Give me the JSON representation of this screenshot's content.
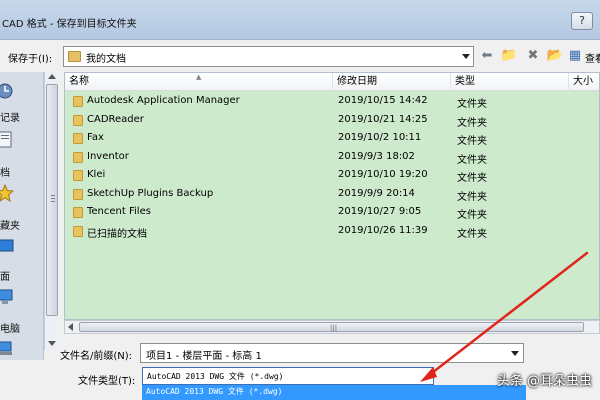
{
  "window": {
    "title": "CAD 格式 - 保存到目标文件夹",
    "help_label": "?"
  },
  "address": {
    "save_in_label": "保存于(I):",
    "current_folder": "我的文档",
    "view_label": "查看"
  },
  "places": {
    "items": [
      {
        "label": "记录",
        "icon": "history-icon"
      },
      {
        "label": "档",
        "icon": "documents-icon"
      },
      {
        "label": "藏夹",
        "icon": "favorites-icon"
      },
      {
        "label": "面",
        "icon": "desktop-icon"
      },
      {
        "label": "电脑",
        "icon": "computer-icon"
      },
      {
        "label": "",
        "icon": "network-icon"
      }
    ]
  },
  "filelist": {
    "columns": [
      "名称",
      "修改日期",
      "类型",
      "大小"
    ],
    "rows": [
      {
        "name": "Autodesk Application Manager",
        "date": "2019/10/15 14:42",
        "type": "文件夹"
      },
      {
        "name": "CADReader",
        "date": "2019/10/21 14:25",
        "type": "文件夹"
      },
      {
        "name": "Fax",
        "date": "2019/10/2 10:11",
        "type": "文件夹"
      },
      {
        "name": "Inventor",
        "date": "2019/9/3 18:02",
        "type": "文件夹"
      },
      {
        "name": "Klei",
        "date": "2019/10/10 19:20",
        "type": "文件夹"
      },
      {
        "name": "SketchUp Plugins Backup",
        "date": "2019/9/9 20:14",
        "type": "文件夹"
      },
      {
        "name": "Tencent Files",
        "date": "2019/10/27 9:05",
        "type": "文件夹"
      },
      {
        "name": "已扫描的文档",
        "date": "2019/10/26 11:39",
        "type": "文件夹"
      }
    ]
  },
  "form": {
    "filename_label": "文件名/前缀(N):",
    "filename_value": "项目1 - 楼层平面 - 标高 1",
    "filetype_label": "文件类型(T):",
    "filetype_value": "AutoCAD 2013 DWG 文件 (*.dwg)",
    "filetype_option": "AutoCAD 2013 DWG 文件 (*.dwg)"
  },
  "watermark": "头条 @耳朵虫虫",
  "colors": {
    "highlight_green": "#cdeacd",
    "selection_blue": "#3399ff",
    "annotation_red": "#e0251b"
  }
}
